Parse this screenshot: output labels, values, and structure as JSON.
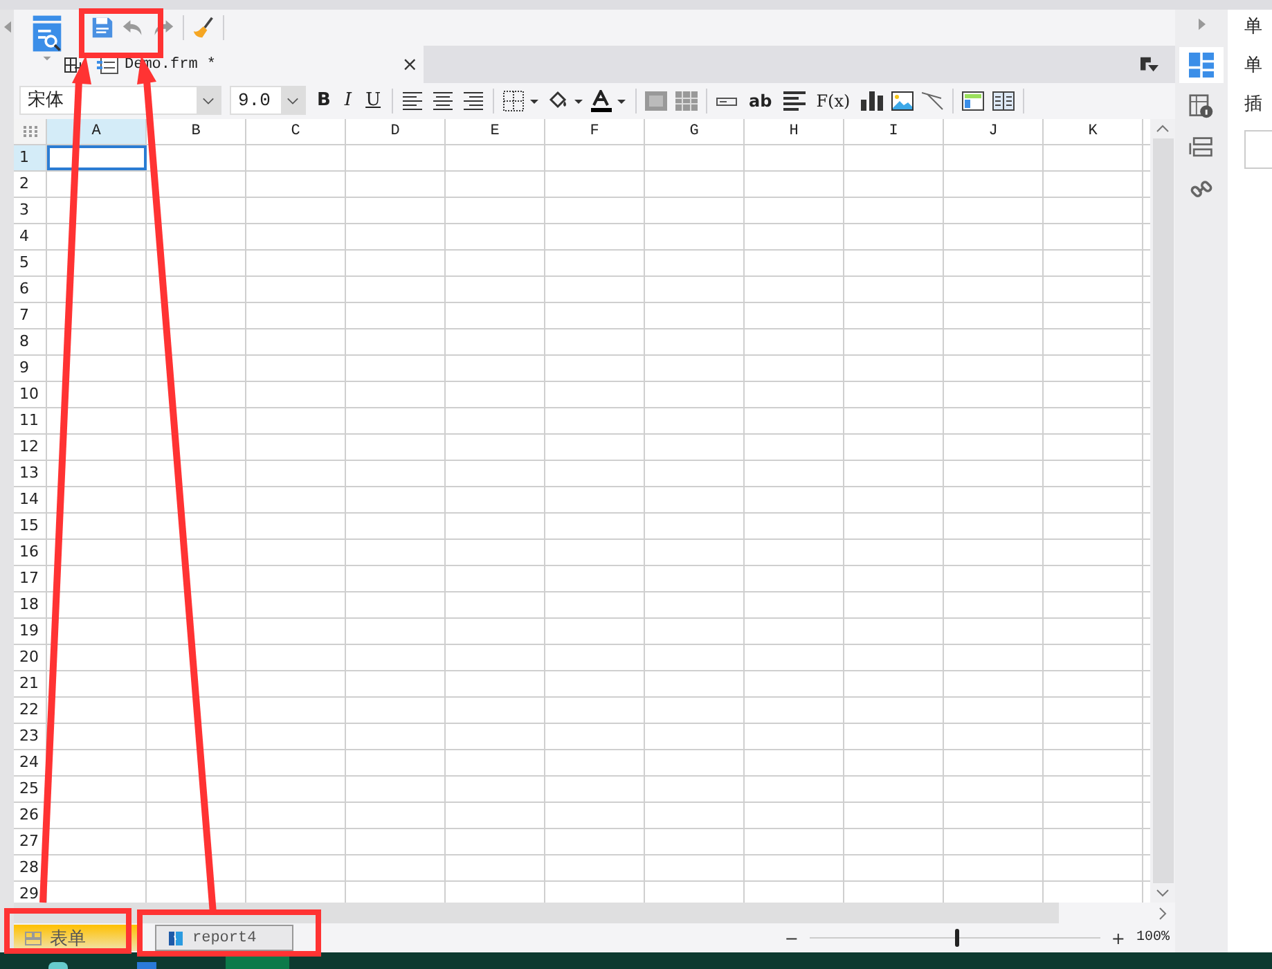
{
  "document_tab": {
    "title": "Demo.frm *",
    "close": "×"
  },
  "format_toolbar": {
    "font": "宋体",
    "size": "9.0",
    "bold": "B",
    "italic": "I",
    "underline": "U",
    "text_tool": "ab",
    "formula_tool": "F(x)"
  },
  "grid": {
    "columns": [
      {
        "label": "A",
        "selected": true
      },
      {
        "label": "B",
        "selected": false
      },
      {
        "label": "C",
        "selected": false
      },
      {
        "label": "D",
        "selected": false
      },
      {
        "label": "E",
        "selected": false
      },
      {
        "label": "F",
        "selected": false
      },
      {
        "label": "G",
        "selected": false
      },
      {
        "label": "H",
        "selected": false
      },
      {
        "label": "I",
        "selected": false
      },
      {
        "label": "J",
        "selected": false
      },
      {
        "label": "K",
        "selected": false
      }
    ],
    "rows": [
      {
        "label": "1",
        "selected": true
      },
      {
        "label": "2",
        "selected": false
      },
      {
        "label": "3",
        "selected": false
      },
      {
        "label": "4",
        "selected": false
      },
      {
        "label": "5",
        "selected": false
      },
      {
        "label": "6",
        "selected": false
      },
      {
        "label": "7",
        "selected": false
      },
      {
        "label": "8",
        "selected": false
      },
      {
        "label": "9",
        "selected": false
      },
      {
        "label": "10",
        "selected": false
      },
      {
        "label": "11",
        "selected": false
      },
      {
        "label": "12",
        "selected": false
      },
      {
        "label": "13",
        "selected": false
      },
      {
        "label": "14",
        "selected": false
      },
      {
        "label": "15",
        "selected": false
      },
      {
        "label": "16",
        "selected": false
      },
      {
        "label": "17",
        "selected": false
      },
      {
        "label": "18",
        "selected": false
      },
      {
        "label": "19",
        "selected": false
      },
      {
        "label": "20",
        "selected": false
      },
      {
        "label": "21",
        "selected": false
      },
      {
        "label": "22",
        "selected": false
      },
      {
        "label": "23",
        "selected": false
      },
      {
        "label": "24",
        "selected": false
      },
      {
        "label": "25",
        "selected": false
      },
      {
        "label": "26",
        "selected": false
      },
      {
        "label": "27",
        "selected": false
      },
      {
        "label": "28",
        "selected": false
      },
      {
        "label": "29",
        "selected": false
      }
    ]
  },
  "sheet_tabs": [
    {
      "label": "表单",
      "selected": true,
      "kind": "form"
    },
    {
      "label": "report4",
      "selected": false,
      "kind": "report"
    }
  ],
  "zoom": {
    "minus": "−",
    "plus": "+",
    "level": 0.5,
    "reading": "100%"
  },
  "side_panel": {
    "lines": [
      "单",
      "单",
      "插"
    ]
  }
}
